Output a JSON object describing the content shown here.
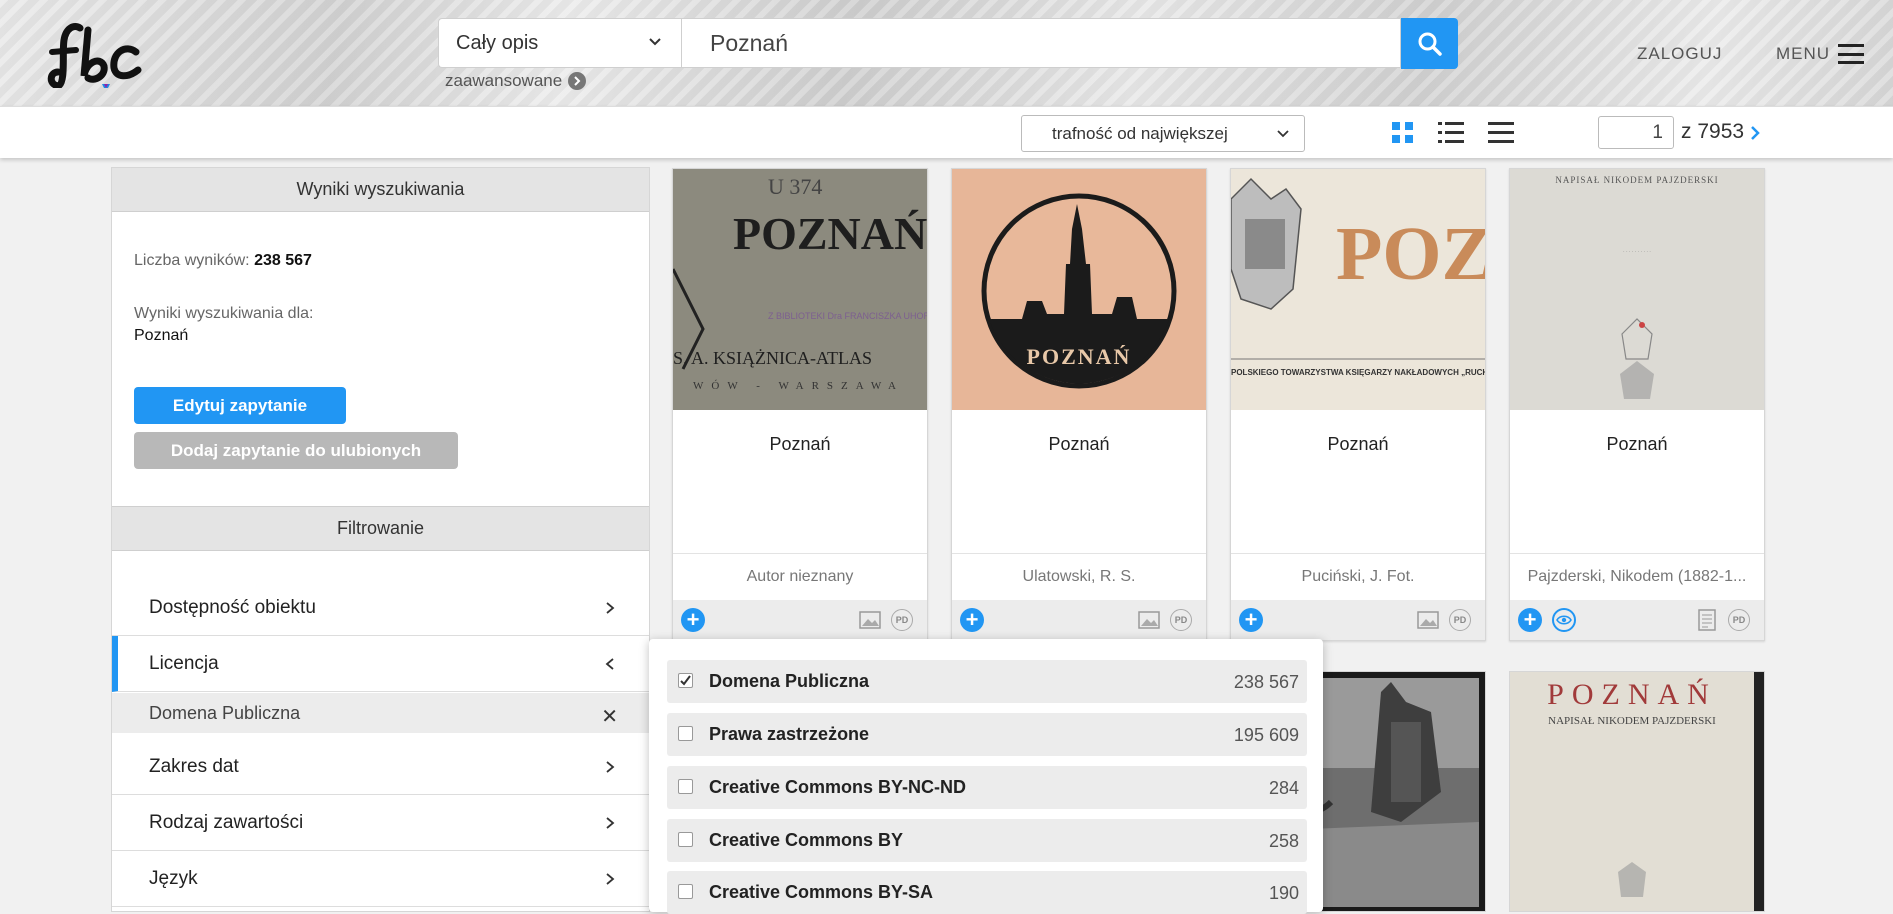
{
  "header": {
    "logo_text": "fbc",
    "scope_select": "Cały opis",
    "search_value": "Poznań",
    "advanced_label": "zaawansowane",
    "login_label": "ZALOGUJ",
    "menu_label": "MENU"
  },
  "toolbar": {
    "sort_select": "trafność od największej",
    "page_current": "1",
    "page_total": "z 7953"
  },
  "sidebar": {
    "results_title": "Wyniki wyszukiwania",
    "count_label": "Liczba wyników:",
    "count_value": "238 567",
    "query_label": "Wyniki wyszukiwania dla:",
    "query_value": "Poznań",
    "edit_button": "Edytuj zapytanie",
    "fav_button": "Dodaj zapytanie do ulubionych",
    "filter_title": "Filtrowanie",
    "filters": [
      {
        "label": "Dostępność obiektu"
      },
      {
        "label": "Licencja"
      },
      {
        "label": "Zakres dat"
      },
      {
        "label": "Rodzaj zawartości"
      },
      {
        "label": "Język"
      }
    ],
    "active_filter_value": "Domena Publiczna"
  },
  "cards": [
    {
      "title": "Poznań",
      "author": "Autor nieznany",
      "cover_text": "POZNAŃ",
      "cover_sub": "S. A. KSIĄŻNICA-ATLAS",
      "cover_stamp": "Z BIBLIOTEKI Dra FRANCISZKA UHORCZAKA",
      "cover_mark": "U 374",
      "cover_city": "WÓW - WARSZAWA"
    },
    {
      "title": "Poznań",
      "author": "Ulatowski, R. S.",
      "cover_text": "POZNAŃ"
    },
    {
      "title": "Poznań",
      "author": "Puciński, J. Fot.",
      "cover_text": "POZNA",
      "cover_sub": "POLSKIEGO TOWARZYSTWA KSIĘGARZY NAKŁADOWYCH „RUCH"
    },
    {
      "title": "Poznań",
      "author": "Pajzderski, Nikodem (1882-1...",
      "cover_text": "NAPISAŁ NIKODEM PAJZDERSKI"
    }
  ],
  "cards_row2": [
    {
      "cover_text": "POZNAŃ",
      "cover_sub": "NAPISAŁ NIKODEM PAJZDERSKI"
    }
  ],
  "license_dropdown": [
    {
      "label": "Domena Publiczna",
      "count": "238 567",
      "checked": true
    },
    {
      "label": "Prawa zastrzeżone",
      "count": "195 609",
      "checked": false
    },
    {
      "label": "Creative Commons BY-NC-ND",
      "count": "284",
      "checked": false
    },
    {
      "label": "Creative Commons BY",
      "count": "258",
      "checked": false
    },
    {
      "label": "Creative Commons BY-SA",
      "count": "190",
      "checked": false
    }
  ],
  "colors": {
    "accent": "#2196f3",
    "muted_button": "#b8b8b8"
  }
}
